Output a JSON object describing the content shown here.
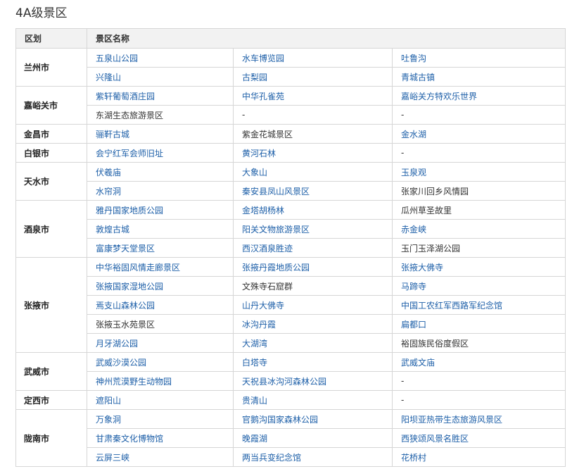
{
  "title": "4A级景区",
  "header": {
    "district": "区划",
    "names": "景区名称"
  },
  "rows": [
    {
      "district": "兰州市",
      "lines": [
        [
          {
            "t": "五泉山公园",
            "link": true
          },
          {
            "t": "水车博览园",
            "link": true
          },
          {
            "t": "吐鲁沟",
            "link": true
          }
        ],
        [
          {
            "t": "兴隆山",
            "link": true
          },
          {
            "t": "古梨园",
            "link": true
          },
          {
            "t": "青城古镇",
            "link": true
          }
        ]
      ]
    },
    {
      "district": "嘉峪关市",
      "lines": [
        [
          {
            "t": "紫轩葡萄酒庄园",
            "link": true
          },
          {
            "t": "中华孔雀苑",
            "link": true
          },
          {
            "t": "嘉峪关方特欢乐世界",
            "link": true
          }
        ],
        [
          {
            "t": "东湖生态旅游景区",
            "link": false
          },
          {
            "t": "-",
            "link": false
          },
          {
            "t": "-",
            "link": false
          }
        ]
      ]
    },
    {
      "district": "金昌市",
      "lines": [
        [
          {
            "t": "骊靬古城",
            "link": true
          },
          {
            "t": "紫金花城景区",
            "link": false
          },
          {
            "t": "金水湖",
            "link": true
          }
        ]
      ]
    },
    {
      "district": "白银市",
      "lines": [
        [
          {
            "t": "会宁红军会师旧址",
            "link": true
          },
          {
            "t": "黄河石林",
            "link": true
          },
          {
            "t": "-",
            "link": false
          }
        ]
      ]
    },
    {
      "district": "天水市",
      "lines": [
        [
          {
            "t": "伏羲庙",
            "link": true
          },
          {
            "t": "大象山",
            "link": true
          },
          {
            "t": "玉泉观",
            "link": true
          }
        ],
        [
          {
            "t": "水帘洞",
            "link": true
          },
          {
            "t": "秦安县凤山风景区",
            "link": true
          },
          {
            "t": "张家川回乡风情园",
            "link": false
          }
        ]
      ]
    },
    {
      "district": "酒泉市",
      "lines": [
        [
          {
            "t": "雅丹国家地质公园",
            "link": true
          },
          {
            "t": "金塔胡杨林",
            "link": true
          },
          {
            "t": "瓜州草圣故里",
            "link": false
          }
        ],
        [
          {
            "t": "敦煌古城",
            "link": true
          },
          {
            "t": "阳关文物旅游景区",
            "link": true
          },
          {
            "t": "赤金峡",
            "link": true
          }
        ],
        [
          {
            "t": "富康梦天堂景区",
            "link": true
          },
          {
            "t": "西汉酒泉胜迹",
            "link": true
          },
          {
            "t": "玉门玉泽湖公园",
            "link": false
          }
        ]
      ]
    },
    {
      "district": "张掖市",
      "lines": [
        [
          {
            "t": "中华裕固风情走廊景区",
            "link": true
          },
          {
            "t": "张掖丹霞地质公园",
            "link": true
          },
          {
            "t": "张掖大佛寺",
            "link": true
          }
        ],
        [
          {
            "t": "张掖国家湿地公园",
            "link": true
          },
          {
            "t": "文殊寺石窟群",
            "link": false
          },
          {
            "t": "马蹄寺",
            "link": true
          }
        ],
        [
          {
            "t": "焉支山森林公园",
            "link": true
          },
          {
            "t": "山丹大佛寺",
            "link": true
          },
          {
            "t": "中国工农红军西路军纪念馆",
            "link": true
          }
        ],
        [
          {
            "t": "张掖玉水苑景区",
            "link": false
          },
          {
            "t": "冰沟丹霞",
            "link": true
          },
          {
            "t": "扁都口",
            "link": true
          }
        ],
        [
          {
            "t": "月牙湖公园",
            "link": true
          },
          {
            "t": "大湖湾",
            "link": true
          },
          {
            "t": "裕固族民俗度假区",
            "link": false
          }
        ]
      ]
    },
    {
      "district": "武威市",
      "lines": [
        [
          {
            "t": "武威沙漠公园",
            "link": true
          },
          {
            "t": "白塔寺",
            "link": true
          },
          {
            "t": "武威文庙",
            "link": true
          }
        ],
        [
          {
            "t": "神州荒漠野生动物园",
            "link": true
          },
          {
            "t": "天祝县冰沟河森林公园",
            "link": true
          },
          {
            "t": "-",
            "link": false
          }
        ]
      ]
    },
    {
      "district": "定西市",
      "lines": [
        [
          {
            "t": "遮阳山",
            "link": true
          },
          {
            "t": "贵清山",
            "link": true
          },
          {
            "t": "-",
            "link": false
          }
        ]
      ]
    },
    {
      "district": "陇南市",
      "lines": [
        [
          {
            "t": "万象洞",
            "link": true
          },
          {
            "t": "官鹅沟国家森林公园",
            "link": true
          },
          {
            "t": "阳坝亚热带生态旅游风景区",
            "link": true
          }
        ],
        [
          {
            "t": "甘肃秦文化博物馆",
            "link": true
          },
          {
            "t": "晚霞湖",
            "link": true
          },
          {
            "t": "西狭颂风景名胜区",
            "link": true
          }
        ],
        [
          {
            "t": "云屏三峡",
            "link": true
          },
          {
            "t": "两当兵变纪念馆",
            "link": true
          },
          {
            "t": "花桥村",
            "link": true
          }
        ]
      ]
    }
  ]
}
